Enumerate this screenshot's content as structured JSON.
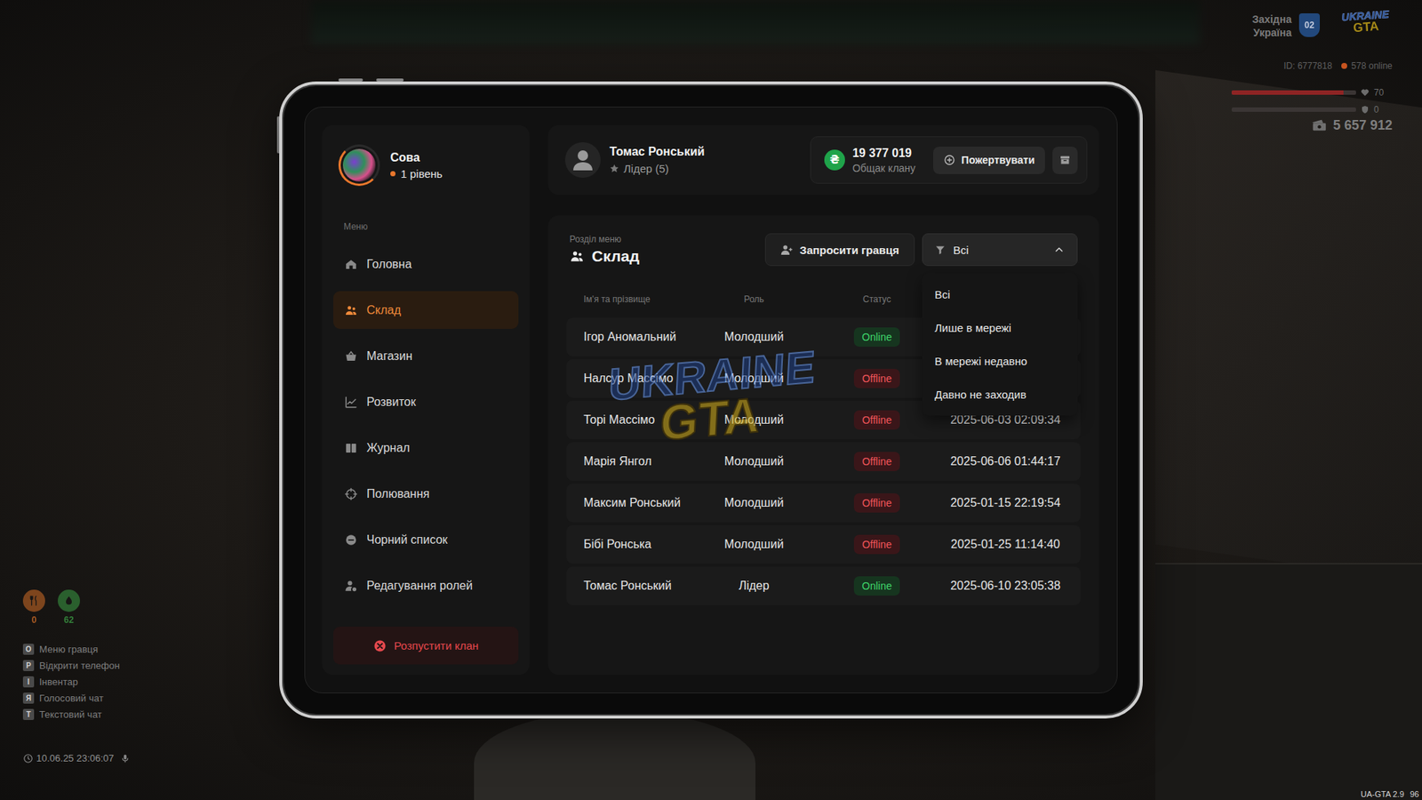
{
  "hud": {
    "region": "Західна Україна",
    "region_badge": "02",
    "logo": {
      "top": "UKRAINE",
      "bottom": "GTA"
    },
    "player_id": "ID: 6777818",
    "players_online": "578 online",
    "health": {
      "level": 0.9,
      "reading": "70"
    },
    "armor": {
      "level": 0,
      "reading": "0"
    },
    "money": "5 657 912",
    "indicators": [
      {
        "reading": "0",
        "color": "#e8782a"
      },
      {
        "reading": "62",
        "color": "#3fae4a"
      }
    ],
    "hotkeys": [
      {
        "key": "O",
        "label": "Меню гравця"
      },
      {
        "key": "P",
        "label": "Відкрити телефон"
      },
      {
        "key": "I",
        "label": "Інвентар"
      },
      {
        "key": "Я",
        "label": "Голосовий чат"
      },
      {
        "key": "T",
        "label": "Текстовий чат"
      }
    ],
    "clock": "10.06.25 23:06:07",
    "version": "UA-GTA 2.9",
    "fps": "96"
  },
  "profile": {
    "name": "Сова",
    "level": "1 рівень"
  },
  "sidebar": {
    "heading": "Меню",
    "items": [
      {
        "label": "Головна",
        "selected": false
      },
      {
        "label": "Склад",
        "selected": true
      },
      {
        "label": "Магазин",
        "selected": false
      },
      {
        "label": "Розвиток",
        "selected": false
      },
      {
        "label": "Журнал",
        "selected": false
      },
      {
        "label": "Полювання",
        "selected": false
      },
      {
        "label": "Чорний список",
        "selected": false
      },
      {
        "label": "Редагування ролей",
        "selected": false
      }
    ],
    "disband_button": "Розпустити клан"
  },
  "user": {
    "name": "Томас Ронський",
    "role": "Лідер (5)"
  },
  "treasury": {
    "currency_icon": "₴",
    "amount": "19 377 019",
    "label": "Общак клану",
    "donate_button": "Пожертвувати"
  },
  "section": {
    "caption": "Розділ меню",
    "title": "Склад",
    "invite_button": "Запросити гравця"
  },
  "filter": {
    "value": "Всі",
    "expanded": true,
    "options": [
      "Всі",
      "Лише в мережі",
      "В мережі недавно",
      "Давно не заходив"
    ]
  },
  "watermark": {
    "top": "UKRAINE",
    "bottom": "GTA"
  },
  "table": {
    "columns": [
      "Ім'я та прізвище",
      "Роль",
      "Статус"
    ],
    "rows": [
      {
        "name": "Ігор Аномальний",
        "role": "Молодший",
        "status": "Online",
        "online": true
      },
      {
        "name": "Налсур Массімо",
        "role": "Молодший",
        "status": "Offline",
        "online": false
      },
      {
        "name": "Торі Массімо",
        "role": "Молодший",
        "status": "Offline",
        "online": false,
        "last_seen": "2025-06-03 02:09:34"
      },
      {
        "name": "Марія Янгол",
        "role": "Молодший",
        "status": "Offline",
        "online": false,
        "last_seen": "2025-06-06 01:44:17"
      },
      {
        "name": "Максим Ронський",
        "role": "Молодший",
        "status": "Offline",
        "online": false,
        "last_seen": "2025-01-15 22:19:54"
      },
      {
        "name": "Бібі Ронська",
        "role": "Молодший",
        "status": "Offline",
        "online": false,
        "last_seen": "2025-01-25 11:14:40"
      },
      {
        "name": "Томас Ронський",
        "role": "Лідер",
        "status": "Online",
        "online": true,
        "last_seen": "2025-06-10 23:05:38"
      }
    ]
  }
}
